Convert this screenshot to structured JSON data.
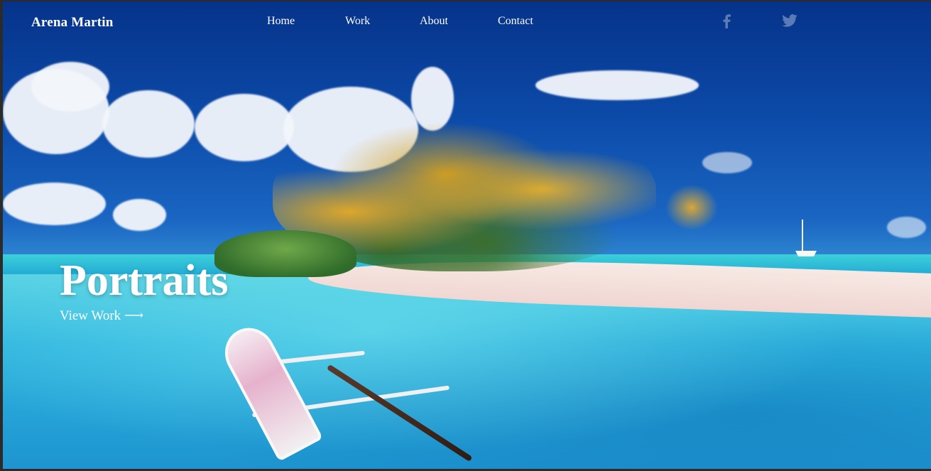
{
  "brand": {
    "name": "Arena Martin"
  },
  "nav": {
    "items": [
      {
        "label": "Home"
      },
      {
        "label": "Work"
      },
      {
        "label": "About"
      },
      {
        "label": "Contact"
      }
    ]
  },
  "social": {
    "icons": [
      "facebook-icon",
      "twitter-icon"
    ],
    "color": "#5a7bb5"
  },
  "hero": {
    "title": "Portraits",
    "cta_label": "View Work",
    "cta_arrow": "⟶"
  },
  "colors": {
    "text": "#ffffff",
    "frame": "#2b2b2b"
  }
}
